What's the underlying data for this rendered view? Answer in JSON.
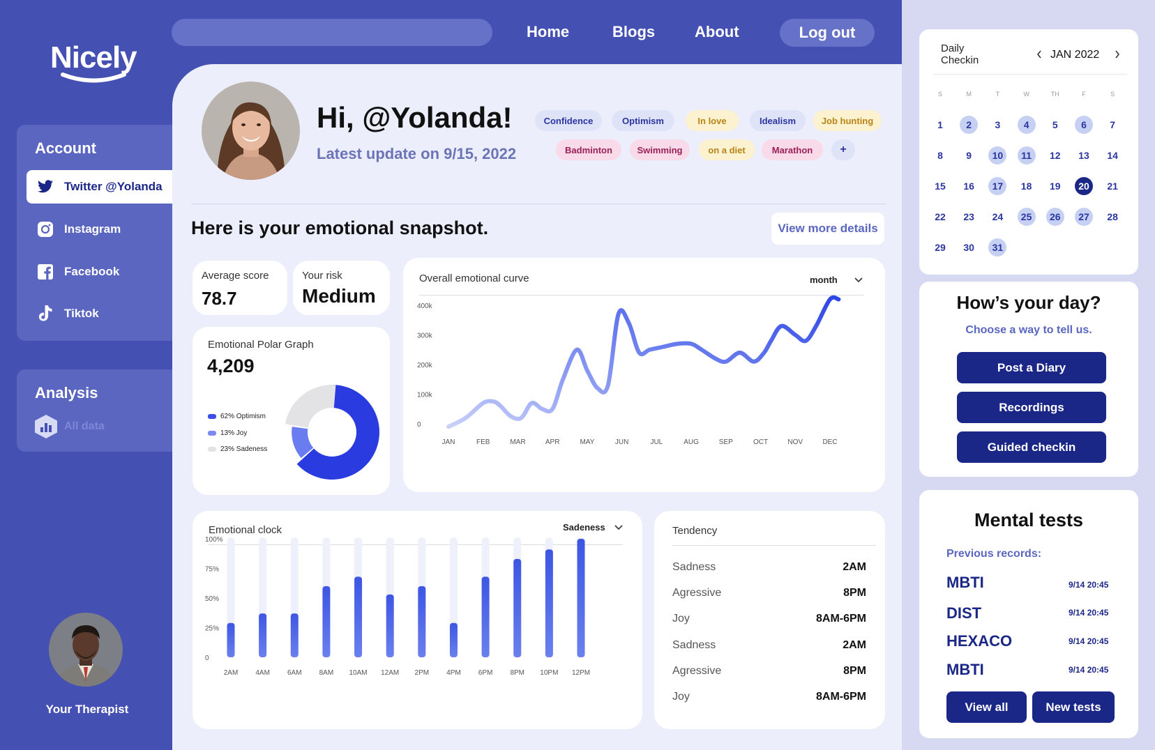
{
  "brand": {
    "name": "Nicely"
  },
  "nav": {
    "home": "Home",
    "blogs": "Blogs",
    "about": "About",
    "logout": "Log out"
  },
  "sidebar": {
    "account_title": "Account",
    "accounts": [
      {
        "label": "Twitter @Yolanda",
        "icon": "twitter-icon"
      },
      {
        "label": "Instagram",
        "icon": "instagram-icon"
      },
      {
        "label": "Facebook",
        "icon": "facebook-icon"
      },
      {
        "label": "Tiktok",
        "icon": "tiktok-icon"
      }
    ],
    "analysis_title": "Analysis",
    "analysis_item": "All data",
    "therapist_label": "Your Therapist"
  },
  "profile": {
    "greeting": "Hi, @Yolanda!",
    "update": "Latest update on 9/15, 2022",
    "tags": [
      "Confidence",
      "Optimism",
      "In love",
      "Idealism",
      "Job hunting",
      "Badminton",
      "Swimming",
      "on a diet",
      "Marathon",
      "+"
    ]
  },
  "snapshot": {
    "title": "Here is your emotional snapshot.",
    "details_button": "View more details"
  },
  "stats": {
    "avg_label": "Average score",
    "avg_value": "78.7",
    "risk_label": "Your risk",
    "risk_value": "Medium"
  },
  "polar": {
    "title": "Emotional Polar Graph",
    "value": "4,209",
    "legend": [
      "62% Optimism",
      "13% Joy",
      "23% Sadeness"
    ]
  },
  "curve": {
    "title": "Overall emotional curve",
    "period": "month"
  },
  "clock": {
    "title": "Emotional clock",
    "filter": "Sadeness"
  },
  "tendency": {
    "title": "Tendency",
    "rows": [
      {
        "k": "Sadness",
        "v": "2AM"
      },
      {
        "k": "Agressive",
        "v": "8PM"
      },
      {
        "k": "Joy",
        "v": "8AM-6PM"
      },
      {
        "k": "Sadness",
        "v": "2AM"
      },
      {
        "k": "Agressive",
        "v": "8PM"
      },
      {
        "k": "Joy",
        "v": "8AM-6PM"
      }
    ]
  },
  "calendar": {
    "title_line1": "Daily",
    "title_line2": "Checkin",
    "month": "JAN 2022",
    "weekdays": [
      "S",
      "M",
      "T",
      "W",
      "TH",
      "F",
      "S"
    ],
    "highlighted": [
      2,
      4,
      6,
      10,
      11,
      17,
      25,
      26,
      27,
      31
    ],
    "selected": 20
  },
  "day": {
    "title": "How’s your day?",
    "subtitle": "Choose a way to tell us.",
    "buttons": [
      "Post a Diary",
      "Recordings",
      "Guided checkin"
    ]
  },
  "tests": {
    "title": "Mental tests",
    "subtitle": "Previous records:",
    "records": [
      {
        "name": "MBTI",
        "date": "9/14 20:45"
      },
      {
        "name": "DIST",
        "date": "9/14 20:45"
      },
      {
        "name": "HEXACO",
        "date": "9/14 20:45"
      },
      {
        "name": "MBTI",
        "date": "9/14 20:45"
      }
    ],
    "view_all": "View all",
    "new_tests": "New tests"
  },
  "chart_data": [
    {
      "type": "line",
      "title": "Overall emotional curve",
      "categories": [
        "JAN",
        "FEB",
        "MAR",
        "APR",
        "MAY",
        "JUN",
        "JUL",
        "AUG",
        "SEP",
        "OCT",
        "NOV",
        "DEC"
      ],
      "y_ticks": [
        "0",
        "100k",
        "200k",
        "300k",
        "400k"
      ],
      "ylim": [
        0,
        400000
      ],
      "x": [
        0,
        0.5,
        1,
        1.3,
        1.5,
        1.8,
        2.1,
        2.4,
        2.7,
        3.0,
        3.3,
        3.7,
        4.0,
        4.3,
        4.6,
        4.9,
        5.2,
        5.5,
        5.8,
        6.2,
        6.6,
        7.0,
        7.3,
        7.7,
        8.0,
        8.4,
        8.8,
        9.1,
        9.3,
        9.6,
        10.0,
        10.3,
        10.6,
        11.0,
        11.25
      ],
      "y": [
        -10000,
        20000,
        70000,
        75000,
        60000,
        25000,
        20000,
        70000,
        50000,
        50000,
        150000,
        250000,
        180000,
        120000,
        130000,
        370000,
        340000,
        240000,
        250000,
        260000,
        270000,
        270000,
        250000,
        220000,
        210000,
        240000,
        210000,
        240000,
        280000,
        330000,
        300000,
        280000,
        330000,
        420000,
        420000
      ]
    },
    {
      "type": "bar",
      "title": "Emotional clock",
      "categories": [
        "2AM",
        "4AM",
        "6AM",
        "8AM",
        "10AM",
        "12AM",
        "2PM",
        "4PM",
        "6PM",
        "8PM",
        "10PM",
        "12PM"
      ],
      "y_ticks": [
        "0",
        "25%",
        "50%",
        "75%",
        "100%"
      ],
      "ylim": [
        0,
        100
      ],
      "values": [
        29,
        37,
        37,
        60,
        68,
        53,
        60,
        29,
        68,
        83,
        91,
        100
      ]
    },
    {
      "type": "pie",
      "title": "Emotional Polar Graph",
      "labels": [
        "Optimism",
        "Joy",
        "Sadeness"
      ],
      "values": [
        62,
        13,
        23
      ],
      "colors": [
        "#2a3be0",
        "#6a7df0",
        "#e3e3e6"
      ]
    }
  ]
}
